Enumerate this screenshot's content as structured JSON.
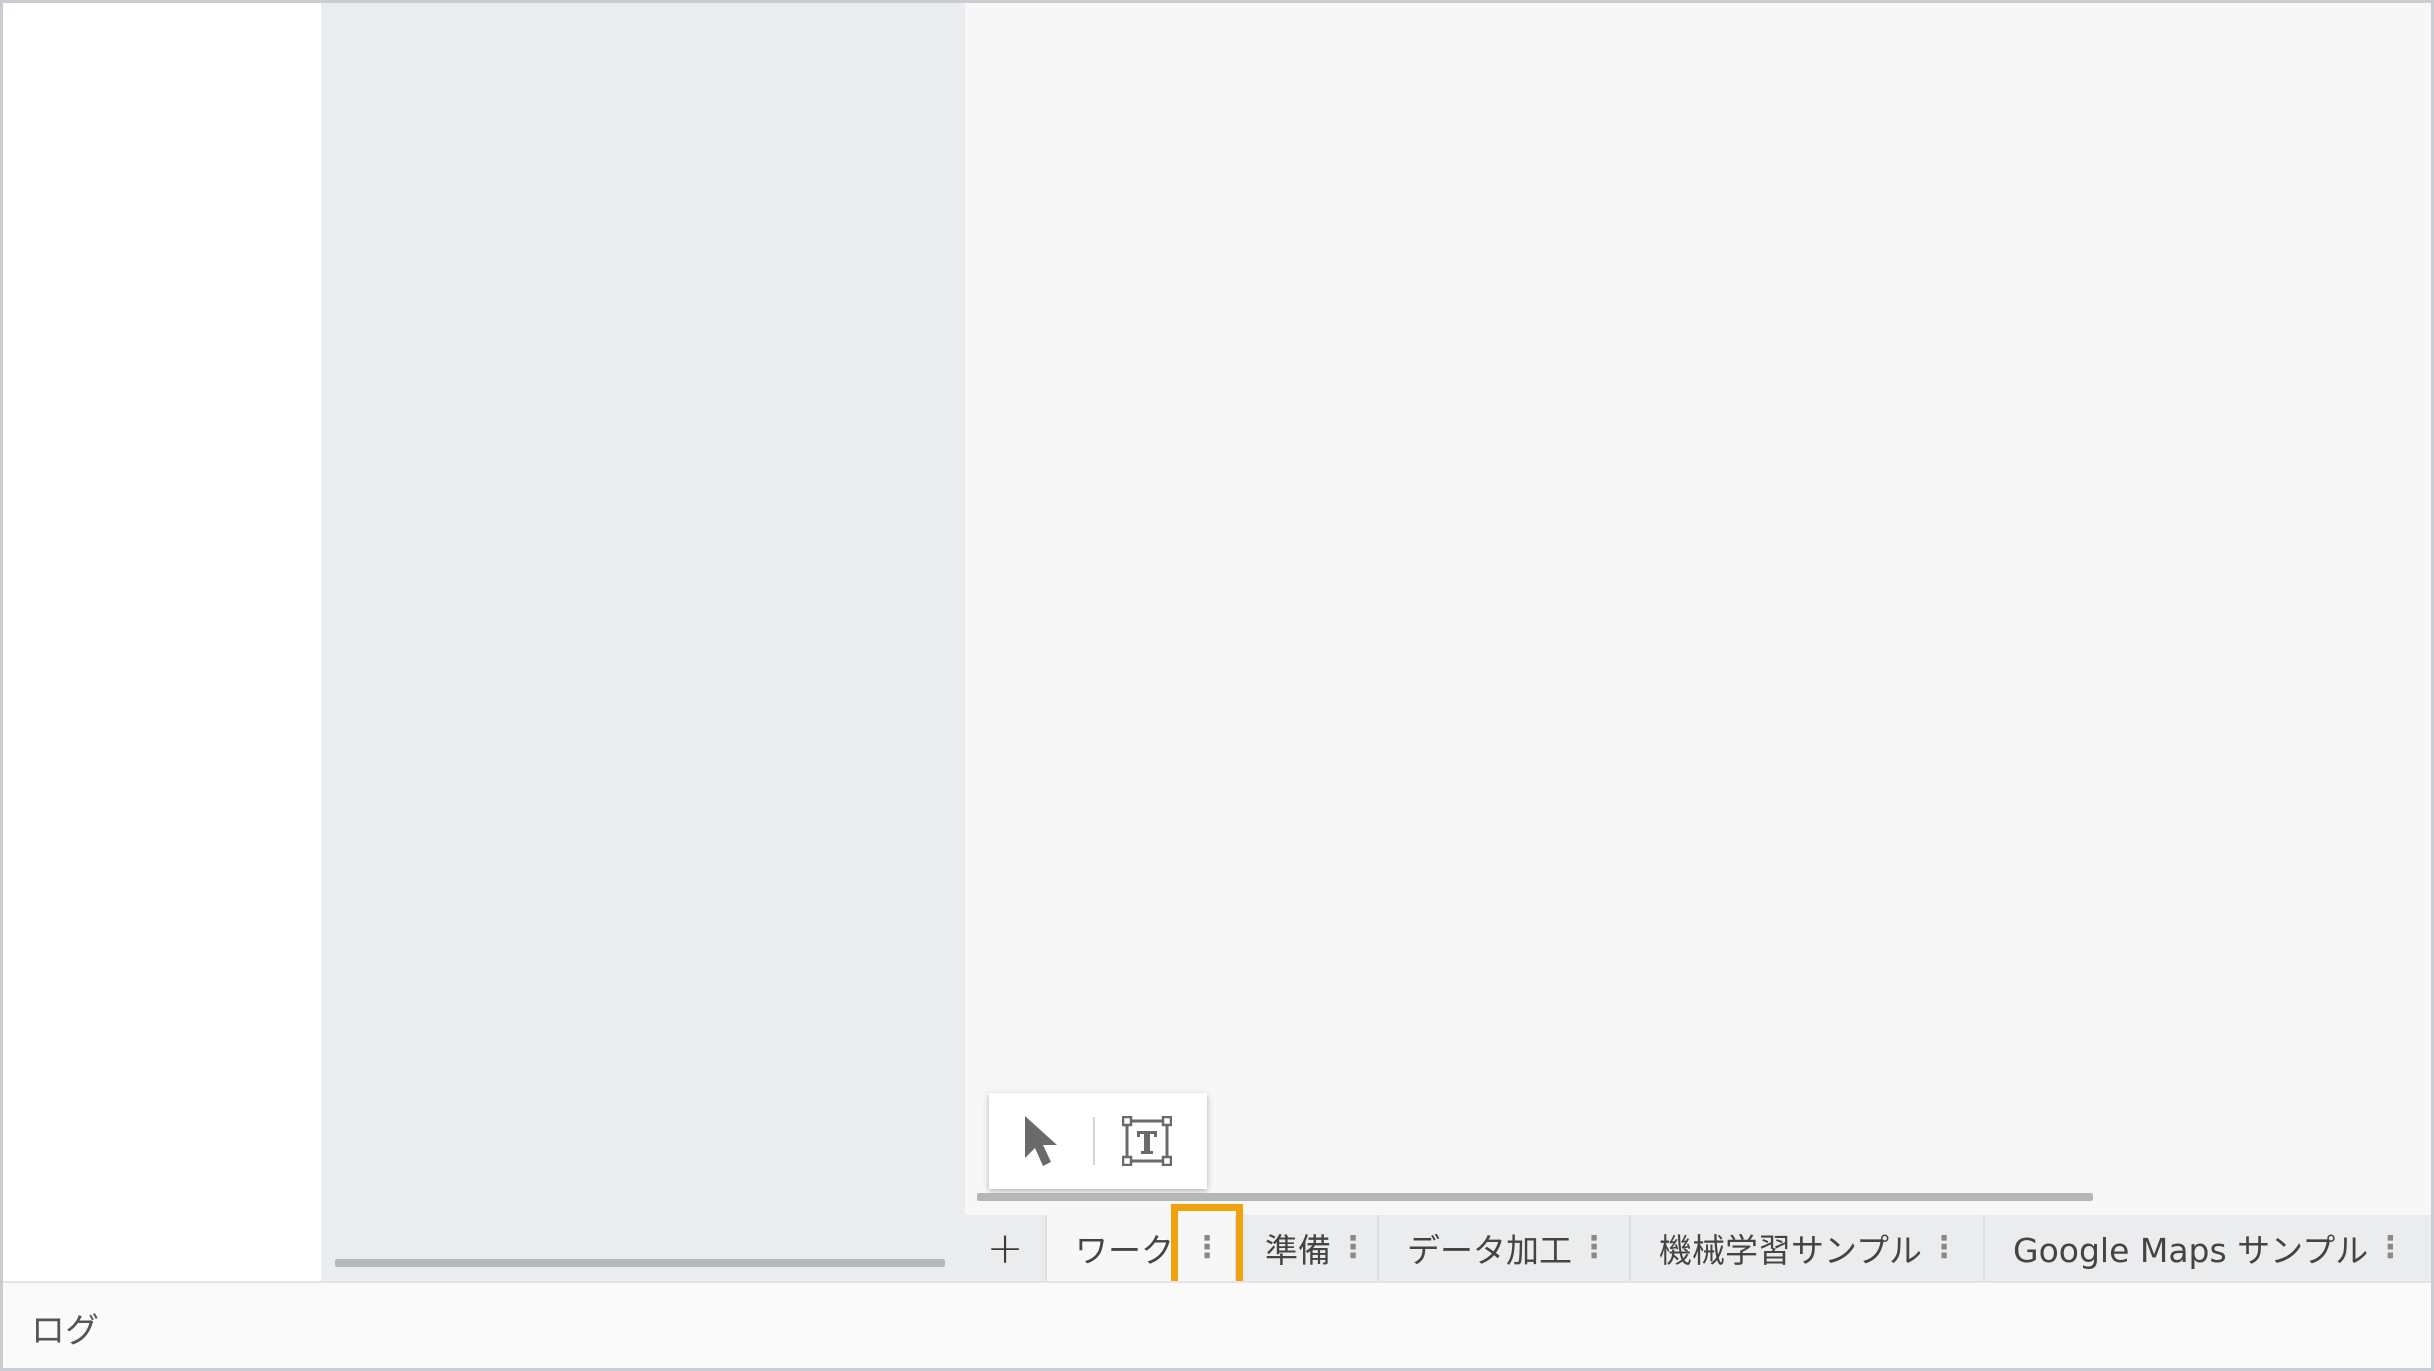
{
  "toolbar": {
    "pointer_icon": "mouse-pointer-icon",
    "text_icon": "text-box-icon"
  },
  "tabbar": {
    "add_label": "+",
    "menu_glyph": "⋮",
    "tabs": [
      {
        "label": "ワーク",
        "active": true
      },
      {
        "label": "準備",
        "active": false
      },
      {
        "label": "データ加工",
        "active": false
      },
      {
        "label": "機械学習サンプル",
        "active": false
      },
      {
        "label": "Google Maps サンプル",
        "active": false
      }
    ]
  },
  "log": {
    "label": "ログ"
  },
  "colors": {
    "highlight": "#f2a20c",
    "mid_pane": "#eaedf0",
    "canvas": "#f7f7f7"
  }
}
